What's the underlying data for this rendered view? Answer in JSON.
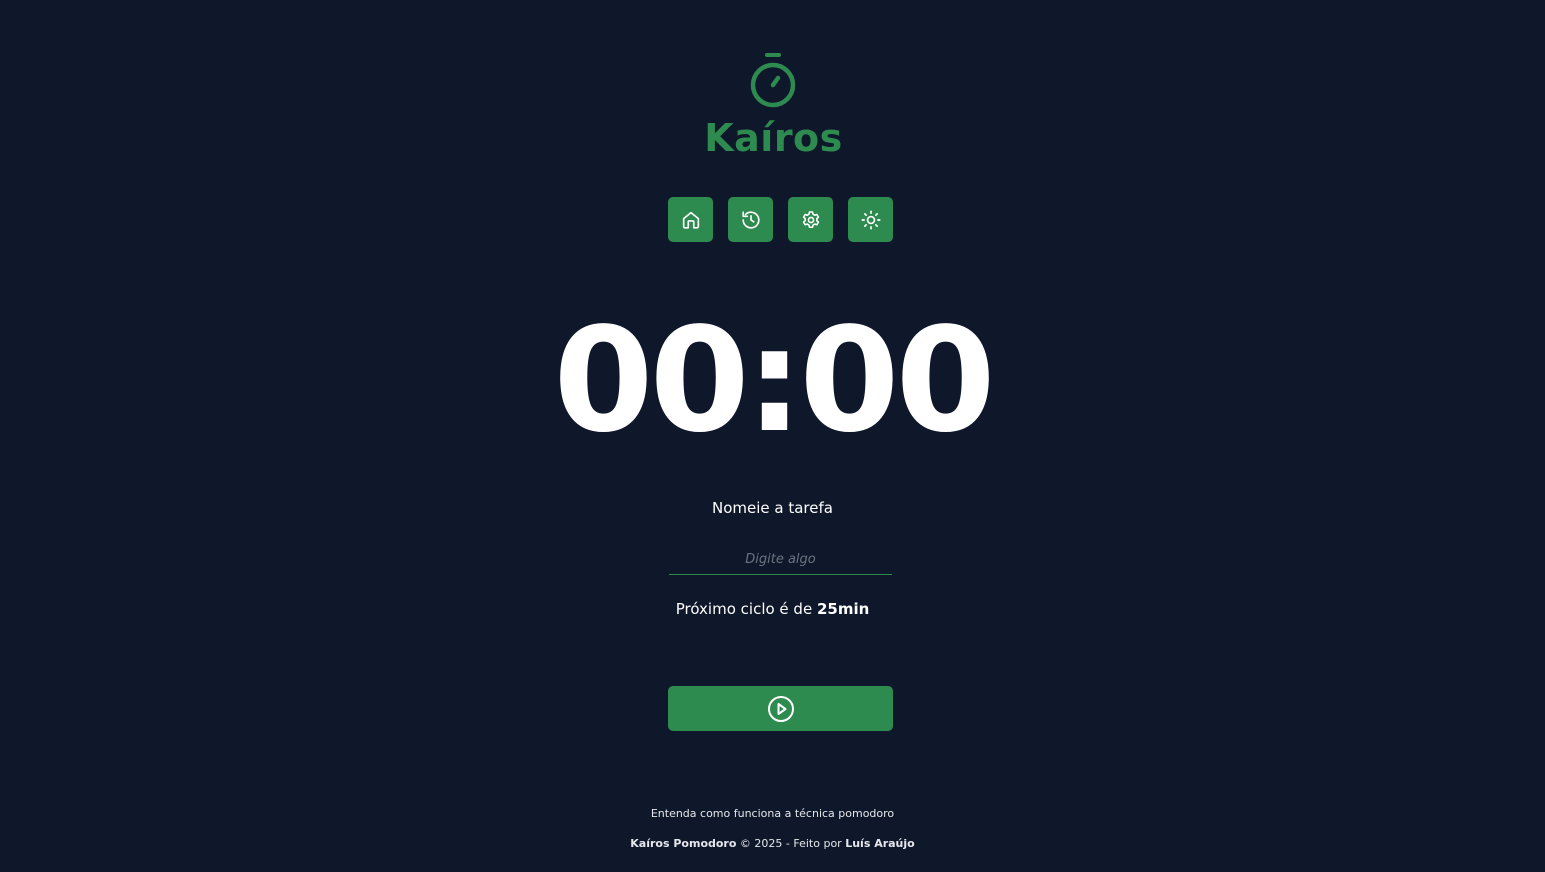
{
  "app": {
    "title": "Kaíros",
    "brand_color": "#2e8b4f",
    "background_color": "#0f172a",
    "logo_icon": "stopwatch-icon"
  },
  "nav": {
    "buttons": [
      {
        "name": "home",
        "icon": "home-icon"
      },
      {
        "name": "history",
        "icon": "history-icon"
      },
      {
        "name": "settings",
        "icon": "gear-icon"
      },
      {
        "name": "theme",
        "icon": "sun-icon"
      }
    ]
  },
  "timer": {
    "display": "00:00"
  },
  "task": {
    "label": "Nomeie a tarefa",
    "placeholder": "Digite algo",
    "value": ""
  },
  "cycle": {
    "prefix": "Próximo ciclo é de ",
    "duration": "25min"
  },
  "play_button": {
    "icon": "play-circle-icon"
  },
  "footer": {
    "link_text": "Entenda como funciona a técnica pomodoro",
    "brand": "Kaíros Pomodoro",
    "copyright": " © 2025 - Feito por ",
    "author": "Luís Araújo"
  }
}
